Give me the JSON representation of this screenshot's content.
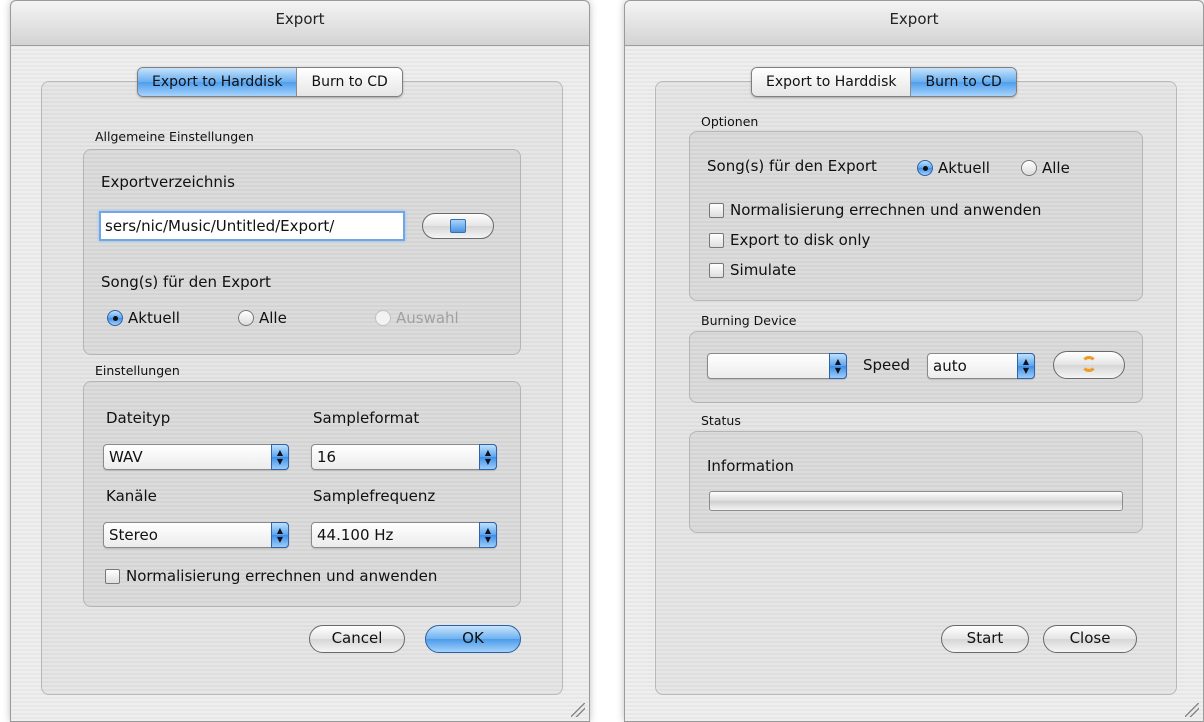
{
  "left_window": {
    "title": "Export",
    "tabs": [
      "Export to Harddisk",
      "Burn to CD"
    ],
    "active_tab": 0,
    "general": {
      "section_label": "Allgemeine Einstellungen",
      "dir_label": "Exportverzeichnis",
      "dir_value": "sers/nic/Music/Untitled/Export/",
      "songs_label": "Song(s) für den Export",
      "radio_current": "Aktuell",
      "radio_all": "Alle",
      "radio_selection": "Auswahl"
    },
    "settings": {
      "section_label": "Einstellungen",
      "filetype_label": "Dateityp",
      "filetype_value": "WAV",
      "sampleformat_label": "Sampleformat",
      "sampleformat_value": "16",
      "channels_label": "Kanäle",
      "channels_value": "Stereo",
      "samplerate_label": "Samplefrequenz",
      "samplerate_value": "44.100 Hz",
      "normalize_label": "Normalisierung errechnen und anwenden"
    },
    "cancel_label": "Cancel",
    "ok_label": "OK"
  },
  "right_window": {
    "title": "Export",
    "tabs": [
      "Export to Harddisk",
      "Burn to CD"
    ],
    "active_tab": 1,
    "options": {
      "section_label": "Optionen",
      "songs_label": "Song(s) für den Export",
      "radio_current": "Aktuell",
      "radio_all": "Alle",
      "normalize_label": "Normalisierung errechnen und anwenden",
      "export_disk_only_label": "Export to disk only",
      "simulate_label": "Simulate"
    },
    "burning": {
      "section_label": "Burning Device",
      "device_value": "",
      "speed_label": "Speed",
      "speed_value": "auto"
    },
    "status": {
      "section_label": "Status",
      "info_label": "Information",
      "progress": 0
    },
    "start_label": "Start",
    "close_label": "Close"
  },
  "colors": {
    "accent_blue": "#5aa5ee",
    "window_bg": "#ececec",
    "refresh_icon": "#f09a2a"
  },
  "icons": {
    "folder_button": "folder-icon",
    "refresh_button": "refresh-icon"
  }
}
